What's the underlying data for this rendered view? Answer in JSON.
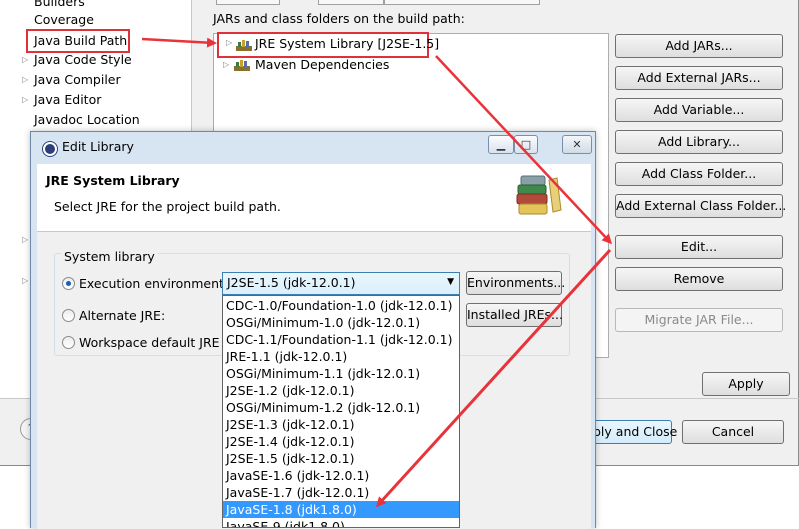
{
  "left_tree": {
    "items": [
      {
        "label": "Builders",
        "has_arrow": false
      },
      {
        "label": "Coverage",
        "has_arrow": false
      },
      {
        "label": "Java Build Path",
        "has_arrow": false
      },
      {
        "label": "Java Code Style",
        "has_arrow": true
      },
      {
        "label": "Java Compiler",
        "has_arrow": true
      },
      {
        "label": "Java Editor",
        "has_arrow": true
      },
      {
        "label": "Javadoc Location",
        "has_arrow": false
      }
    ]
  },
  "build_path": {
    "label": "JARs and class folders on the build path:",
    "libraries": [
      {
        "label": "JRE System Library [J2SE-1.5]"
      },
      {
        "label": "Maven Dependencies"
      }
    ]
  },
  "side_buttons": {
    "add_jars": "Add JARs...",
    "add_external_jars": "Add External JARs...",
    "add_variable": "Add Variable...",
    "add_library": "Add Library...",
    "add_class_folder": "Add Class Folder...",
    "add_external_class_folder": "Add External Class Folder...",
    "edit": "Edit...",
    "remove": "Remove",
    "migrate_jar": "Migrate JAR File..."
  },
  "bottom_buttons": {
    "apply": "Apply",
    "apply_and_close": "ply and Close",
    "cancel": "Cancel"
  },
  "dialog": {
    "title": "Edit Library",
    "header_title": "JRE System Library",
    "header_desc": "Select JRE for the project build path.",
    "group_label": "System library",
    "radio_execution": "Execution environment:",
    "radio_alternate": "Alternate JRE:",
    "radio_workspace": "Workspace default JRE (",
    "combo_value": "J2SE-1.5 (jdk-12.0.1)",
    "environments_button": "Environments...",
    "installed_jres_button": "Installed JREs...",
    "options": [
      "CDC-1.0/Foundation-1.0 (jdk-12.0.1)",
      "OSGi/Minimum-1.0 (jdk-12.0.1)",
      "CDC-1.1/Foundation-1.1 (jdk-12.0.1)",
      "JRE-1.1 (jdk-12.0.1)",
      "OSGi/Minimum-1.1 (jdk-12.0.1)",
      "J2SE-1.2 (jdk-12.0.1)",
      "OSGi/Minimum-1.2 (jdk-12.0.1)",
      "J2SE-1.3 (jdk-12.0.1)",
      "J2SE-1.4 (jdk-12.0.1)",
      "J2SE-1.5 (jdk-12.0.1)",
      "JavaSE-1.6 (jdk-12.0.1)",
      "JavaSE-1.7 (jdk-12.0.1)",
      "JavaSE-1.8 (jdk1.8.0)",
      "JavaSE-9 (jdk1.8.0)"
    ],
    "selected_option_index": 12
  },
  "colors": {
    "annotation": "#e8333a",
    "selection": "#3399ff"
  }
}
